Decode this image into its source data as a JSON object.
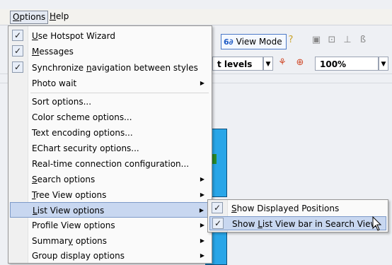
{
  "menubar": {
    "options_label": "Options",
    "options_underline": "O",
    "options_rest": "ptions",
    "help_label": "Help",
    "help_underline": "H",
    "help_rest": "elp"
  },
  "toolbar": {
    "view_mode_label": "View Mode",
    "levels_label": "t levels",
    "zoom_value": "100%"
  },
  "menu": {
    "items": [
      {
        "pre": "",
        "u": "U",
        "post": "se Hotspot Wizard",
        "checked": true
      },
      {
        "pre": "",
        "u": "M",
        "post": "essages",
        "checked": true
      },
      {
        "pre": "Synchronize ",
        "u": "n",
        "post": "avigation between styles",
        "checked": true
      },
      {
        "pre": "Photo wait",
        "u": "",
        "post": "",
        "submenu": true
      },
      {
        "pre": "Sort options...",
        "u": "",
        "post": ""
      },
      {
        "pre": "Color scheme options...",
        "u": "",
        "post": ""
      },
      {
        "pre": "Text encoding options...",
        "u": "",
        "post": ""
      },
      {
        "pre": "EChart security options...",
        "u": "",
        "post": ""
      },
      {
        "pre": "Real-time connection configuration...",
        "u": "",
        "post": ""
      },
      {
        "pre": "",
        "u": "S",
        "post": "earch options",
        "submenu": true
      },
      {
        "pre": "",
        "u": "T",
        "post": "ree View options",
        "submenu": true
      },
      {
        "pre": "",
        "u": "L",
        "post": "ist View options",
        "submenu": true,
        "highlighted": true
      },
      {
        "pre": "Profile View options",
        "u": "",
        "post": "",
        "submenu": true
      },
      {
        "pre": "Summar",
        "u": "y",
        "post": " options",
        "submenu": true
      },
      {
        "pre": "Group display options",
        "u": "",
        "post": "",
        "submenu": true
      }
    ]
  },
  "submenu": {
    "items": [
      {
        "pre": "",
        "u": "S",
        "post": "how Displayed Positions",
        "checked": true
      },
      {
        "pre": "Show ",
        "u": "L",
        "post": "ist View bar in Search View",
        "checked": true,
        "highlighted": true
      }
    ]
  },
  "icons": {
    "check": "check-icon",
    "submenu_arrow": "submenu-arrow-icon"
  },
  "colors": {
    "highlight": "#c8d7f0",
    "highlight_border": "#7d9ac8",
    "node_fill": "#29a6e8"
  }
}
